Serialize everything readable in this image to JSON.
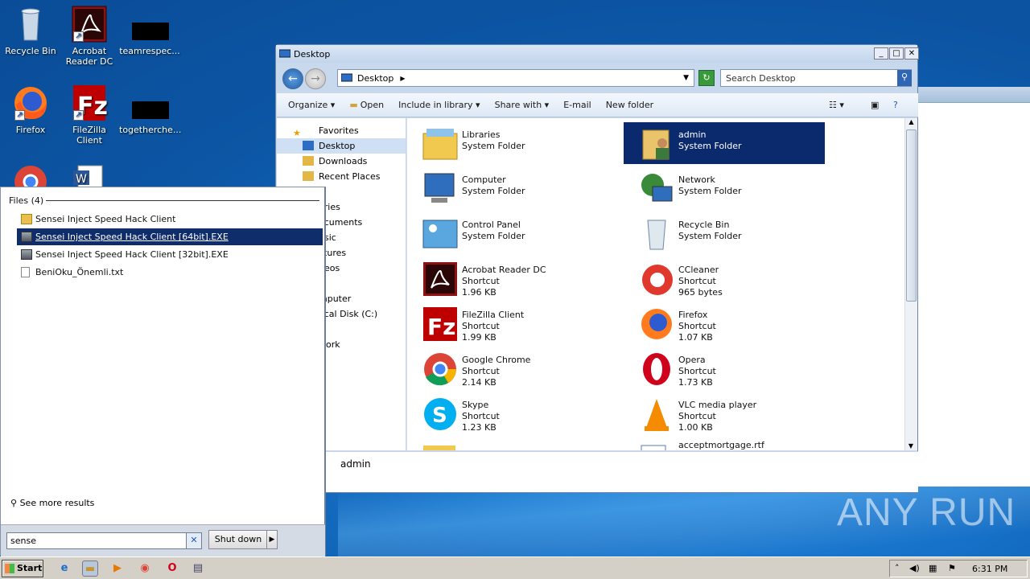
{
  "desktop": {
    "icons": [
      {
        "label": "Recycle Bin",
        "icon": "recycle-bin-icon"
      },
      {
        "label": "Acrobat\nReader DC",
        "l1": "Acrobat",
        "l2": "Reader DC",
        "icon": "acrobat-icon"
      },
      {
        "label": "teamrespec...",
        "icon": "redacted-icon"
      },
      {
        "label": "Firefox",
        "icon": "firefox-icon"
      },
      {
        "label": "FileZilla Client",
        "icon": "filezilla-icon"
      },
      {
        "label": "togetherche...",
        "icon": "redacted-icon"
      }
    ],
    "watermark": "ANY RUN"
  },
  "explorer": {
    "title": "Desktop",
    "address": "Desktop",
    "search_placeholder": "Search Desktop",
    "commands": [
      "Organize",
      "Open",
      "Include in library",
      "Share with",
      "E-mail",
      "New folder"
    ],
    "nav": [
      "Favorites",
      "Desktop",
      "Downloads",
      "Recent Places",
      "aries",
      "ocuments",
      "usic",
      "ctures",
      "deos",
      "mputer",
      "ocal Disk (C:)",
      "work"
    ],
    "items": [
      {
        "name": "Libraries",
        "type": "System Folder",
        "size": ""
      },
      {
        "name": "admin",
        "type": "System Folder",
        "size": ""
      },
      {
        "name": "Computer",
        "type": "System Folder",
        "size": ""
      },
      {
        "name": "Network",
        "type": "System Folder",
        "size": ""
      },
      {
        "name": "Control Panel",
        "type": "System Folder",
        "size": ""
      },
      {
        "name": "Recycle Bin",
        "type": "System Folder",
        "size": ""
      },
      {
        "name": "Acrobat Reader DC",
        "type": "Shortcut",
        "size": "1.96 KB"
      },
      {
        "name": "CCleaner",
        "type": "Shortcut",
        "size": "965 bytes"
      },
      {
        "name": "FileZilla Client",
        "type": "Shortcut",
        "size": "1.99 KB"
      },
      {
        "name": "Firefox",
        "type": "Shortcut",
        "size": "1.07 KB"
      },
      {
        "name": "Google Chrome",
        "type": "Shortcut",
        "size": "2.14 KB"
      },
      {
        "name": "Opera",
        "type": "Shortcut",
        "size": "1.73 KB"
      },
      {
        "name": "Skype",
        "type": "Shortcut",
        "size": "1.23 KB"
      },
      {
        "name": "VLC media player",
        "type": "Shortcut",
        "size": "1.00 KB"
      },
      {
        "name": "acceptmortgage.rtf",
        "type": "",
        "size": ""
      }
    ],
    "details_name": "admin"
  },
  "startmenu": {
    "header": "Files (4)",
    "results": [
      "Sensei Inject Speed Hack Client",
      "Sensei Inject Speed Hack Client [64bit].EXE",
      "Sensei Inject Speed Hack Client [32bit].EXE",
      "BeniOku_Önemli.txt"
    ],
    "see_more": "See more results",
    "search_value": "sense",
    "shutdown": "Shut down"
  },
  "taskbar": {
    "start": "Start",
    "clock": "6:31 PM"
  }
}
